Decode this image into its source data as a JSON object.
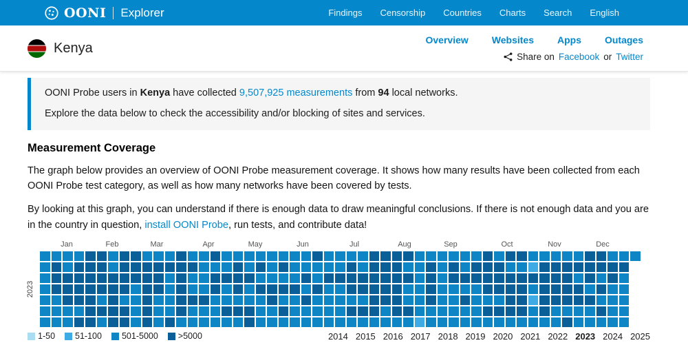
{
  "navbar": {
    "brand": {
      "name": "OONI",
      "product": "Explorer"
    },
    "items": [
      {
        "label": "Findings"
      },
      {
        "label": "Censorship"
      },
      {
        "label": "Countries"
      },
      {
        "label": "Charts"
      },
      {
        "label": "Search"
      },
      {
        "label": "English"
      }
    ],
    "bg_color": "#0588CB"
  },
  "country_header": {
    "country_name": "Kenya",
    "tabs": [
      {
        "label": "Overview"
      },
      {
        "label": "Websites"
      },
      {
        "label": "Apps"
      },
      {
        "label": "Outages"
      }
    ],
    "share": {
      "prefix": "Share on",
      "facebook": "Facebook",
      "or": "or",
      "twitter": "Twitter"
    }
  },
  "summary_box": {
    "line1_pre": "OONI Probe users in ",
    "line1_country": "Kenya",
    "line1_mid": " have collected ",
    "line1_link": "9,507,925 measurements",
    "line1_from": " from ",
    "line1_networks": "94",
    "line1_post": " local networks.",
    "line2": "Explore the data below to check the accessibility and/or blocking of sites and services."
  },
  "coverage": {
    "heading": "Measurement Coverage",
    "para1": "The graph below provides an overview of OONI Probe measurement coverage. It shows how many results have been collected from each OONI Probe test category, as well as how many networks have been covered by tests.",
    "para2_pre": "By looking at this graph, you can understand if there is enough data to draw meaningful conclusions. If there is not enough data and you are in the country in question, ",
    "para2_link": "install OONI Probe",
    "para2_post": ", run tests, and contribute data!"
  },
  "chart_data": {
    "type": "heatmap",
    "title": "Measurement coverage calendar heatmap",
    "year_label": "2023",
    "months": [
      "Jan",
      "Feb",
      "Mar",
      "Apr",
      "May",
      "Jun",
      "Jul",
      "Aug",
      "Sep",
      "Oct",
      "Nov",
      "Dec"
    ],
    "weeks": 53,
    "days_per_week": 7,
    "value_encoding": {
      "X": "1-50",
      "L": "51-100",
      "M": "501-5000",
      "D": ">5000"
    },
    "legend": [
      {
        "label": "1-50",
        "color": "#AADCF2",
        "code": "X"
      },
      {
        "label": "51-100",
        "color": "#3FABE5",
        "code": "L"
      },
      {
        "label": "501-5000",
        "color": "#0E86C5",
        "code": "M"
      },
      {
        "label": ">5000",
        "color": "#0A5F99",
        "code": "D"
      }
    ],
    "pattern": [
      "MMMMMMM",
      "MDDDMMM",
      "MMDDDMM",
      "MDDDDMD",
      "DDDDDDD",
      "DDDDMDM",
      "MMDDDDD",
      "DDDDMDD",
      "DDDMMMM",
      "MDDDDDD",
      "MDDDMMM",
      "MDMMMMD",
      "DDDDDDM",
      "MDMMDMM",
      "MMMMDMM",
      "DMDDMMM",
      "MMDMMDM",
      "MDDDMDM",
      "MMDMMDD",
      "MDMDMMM",
      "MMMDDMM",
      "MDMDMDM",
      "MMMDMMM",
      "MMDMDMM",
      "DMMDMMM",
      "MMDMMMM",
      "MMDMMMM",
      "MDDDMDM",
      "MMDDMDM",
      "DDDDDDM",
      "DDDDDMM",
      "DDDDDDM",
      "DMDMMDM",
      "MMMMMML",
      "MDDDDMM",
      "MMMMMMM",
      "MDDMMMM",
      "MMDMDMM",
      "MDDMMMM",
      "DDDDMDM",
      "MDDDMDM",
      "DMDDDDM",
      "DMDDDDM",
      "MLDMLMM",
      "MDDDDDM",
      "MDDDDMM",
      "MDDDDMD",
      "MDMDDMM",
      "DDDMDMM",
      "DDMDMDM",
      "MDDMMMM",
      "MDMMMMM",
      "M"
    ],
    "years": [
      "2014",
      "2015",
      "2016",
      "2017",
      "2018",
      "2019",
      "2020",
      "2021",
      "2022",
      "2023",
      "2024",
      "2025"
    ],
    "selected_year": "2023"
  }
}
